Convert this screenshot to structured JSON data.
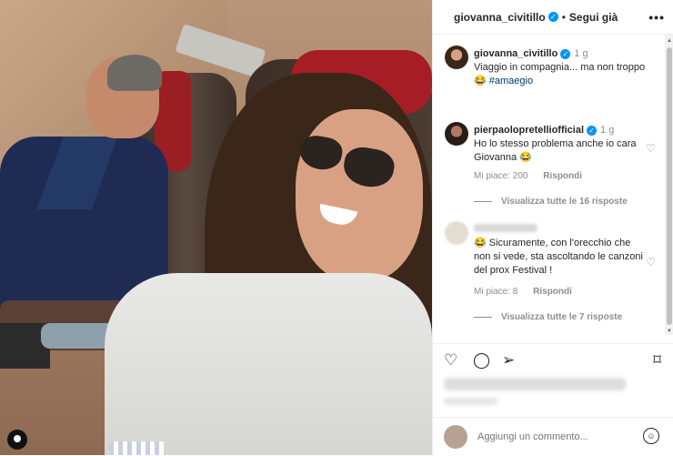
{
  "post": {
    "username": "giovanna_civitillo",
    "follow_label": "Segui già",
    "more_label": "•••"
  },
  "caption": {
    "username": "giovanna_civitillo",
    "time": "1 g",
    "text": "Viaggio in compagnia... ma non troppo",
    "emoji": "😂",
    "hashtag": "#amaegio"
  },
  "comments": [
    {
      "username": "pierpaolopretelliofficial",
      "time": "1 g",
      "text": "Ho lo stesso problema anche io cara Giovanna 😂",
      "likes": "Mi piace: 200",
      "reply_label": "Rispondi",
      "replies": "Visualizza tutte le 16 risposte"
    },
    {
      "text": "😂 Sicuramente, con l'orecchio che non si vede, sta ascoltando le canzoni del prox Festival !",
      "likes": "Mi piace: 8",
      "reply_label": "Rispondi",
      "replies": "Visualizza tutte le 7 risposte"
    }
  ],
  "add_comment": {
    "placeholder": "Aggiungi un commento..."
  },
  "icons": [
    "heart-icon",
    "comment-icon",
    "share-icon",
    "bookmark-icon",
    "emoji-icon",
    "verified-icon",
    "more-icon",
    "tag-icon"
  ]
}
